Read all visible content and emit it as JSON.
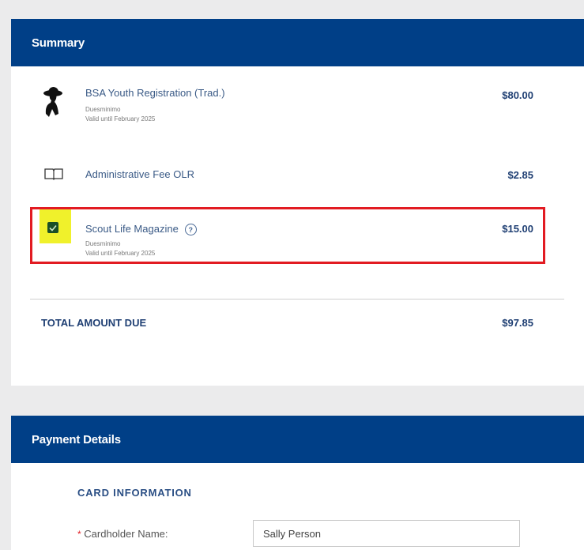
{
  "summary": {
    "header": "Summary",
    "items": [
      {
        "icon": "scout-silhouette-icon",
        "name": "BSA Youth Registration (Trad.)",
        "sub1": "Duesminimo",
        "sub2": "Valid until February 2025",
        "price": "$80.00"
      },
      {
        "icon": "book-icon",
        "name": "Administrative Fee OLR",
        "price": "$2.85"
      },
      {
        "icon": "checkbox-checked",
        "name": "Scout Life Magazine",
        "sub1": "Duesminimo",
        "sub2": "Valid until February 2025",
        "price": "$15.00",
        "checked": true
      }
    ],
    "total_label": "TOTAL AMOUNT DUE",
    "total_value": "$97.85"
  },
  "payment": {
    "header": "Payment Details",
    "card_info_label": "CARD INFORMATION",
    "cardholder_label": "Cardholder Name:",
    "cardholder_required": "*",
    "cardholder_value": "Sally Person"
  },
  "colors": {
    "header_bg": "#003f87",
    "highlight_red": "#e21b22",
    "highlight_yellow": "#f0f12b",
    "checkbox_green": "#1b4f27"
  }
}
